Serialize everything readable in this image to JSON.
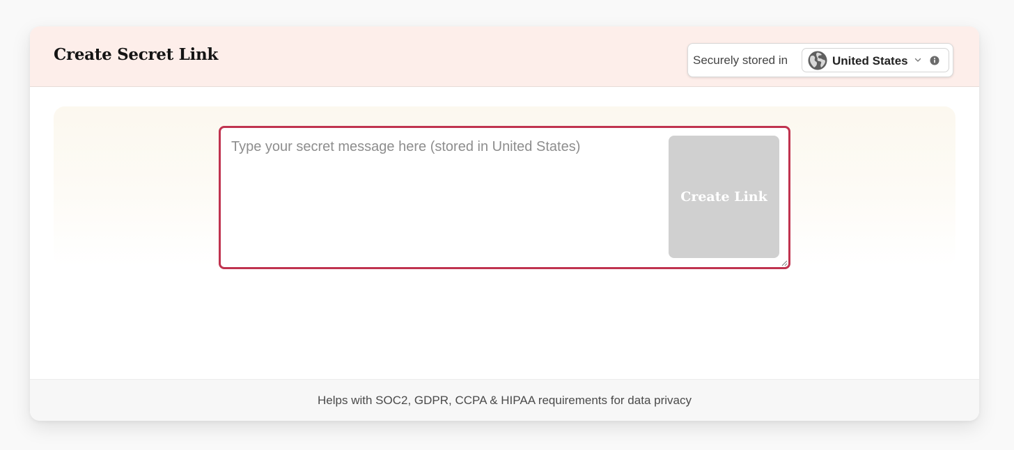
{
  "header": {
    "title": "Create Secret Link",
    "storage_label": "Securely stored in",
    "region": {
      "selected": "United States",
      "icon": "globe-icon",
      "dropdown_icon": "chevron-down-icon",
      "info_icon": "info-icon"
    }
  },
  "composer": {
    "placeholder": "Type your secret message here (stored in United States)",
    "value": "",
    "create_button_label": "Create Link"
  },
  "footer": {
    "text": "Helps with SOC2, GDPR, CCPA & HIPAA requirements for data privacy"
  },
  "colors": {
    "header_bg": "#fdeeea",
    "input_border_focus": "#c0334f",
    "button_disabled_bg": "#d0d0d0",
    "footer_bg": "#f7f7f7"
  }
}
